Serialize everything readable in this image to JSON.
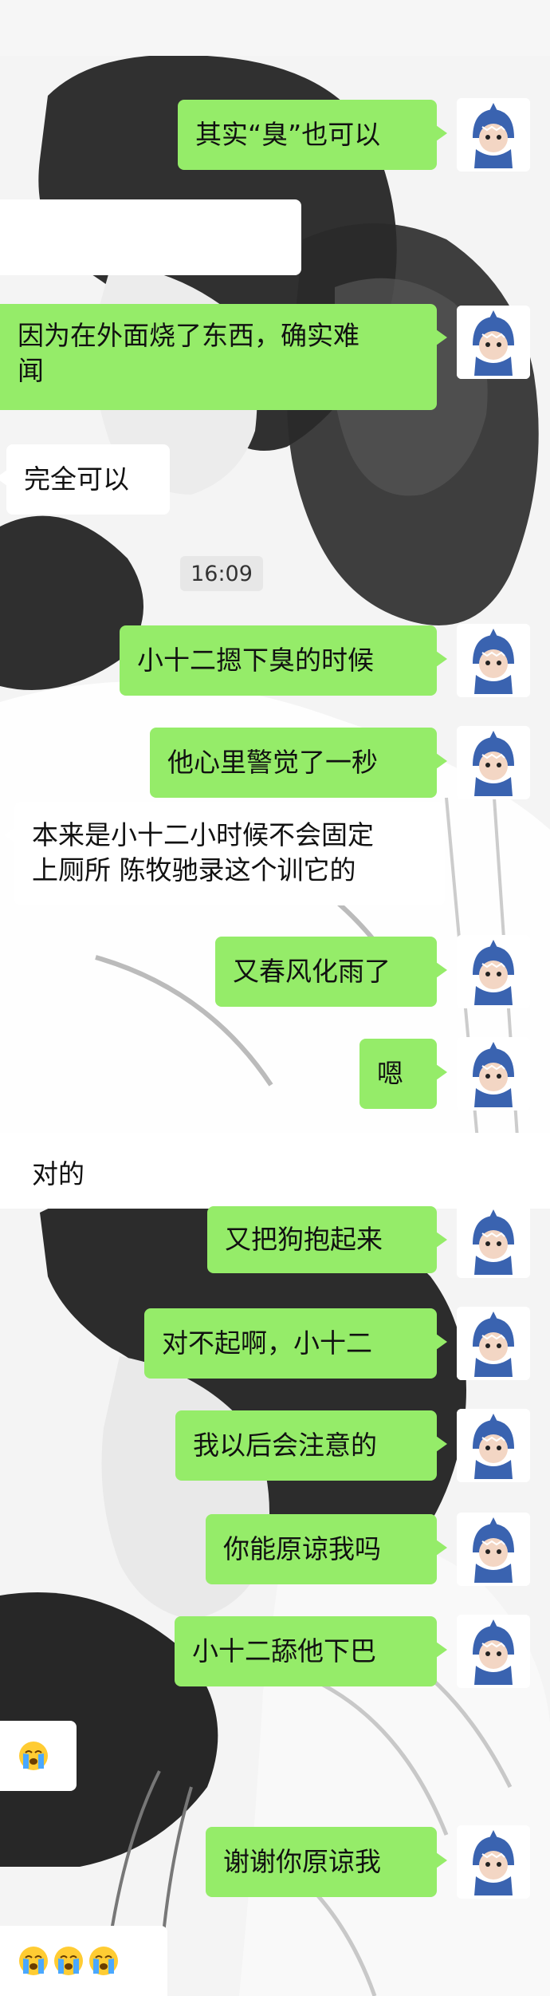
{
  "timestamp": "16:09",
  "messages": [
    {
      "text": "其实“臭”也可以"
    },
    {
      "text": ""
    },
    {
      "text": "因为在外面烧了东西，确实难闻"
    },
    {
      "text": "完全可以"
    },
    {
      "text": "小十二摁下臭的时候"
    },
    {
      "text": "他心里警觉了一秒"
    },
    {
      "text": "本来是小十二小时候不会固定上厕所 陈牧驰录这个训它的"
    },
    {
      "text": "又春风化雨了"
    },
    {
      "text": "嗯"
    },
    {
      "text": "对的"
    },
    {
      "text": "又把狗抱起来"
    },
    {
      "text": "对不起啊，小十二"
    },
    {
      "text": "我以后会注意的"
    },
    {
      "text": "你能原谅我吗"
    },
    {
      "text": "小十二舔他下巴"
    },
    {
      "text": "谢谢你原谅我"
    }
  ],
  "lines": {
    "m2_l1": "因为在外面烧了东西，确实难",
    "m2_l2": "闻",
    "m6_l1": "本来是小十二小时候不会固定",
    "m6_l2": "上厕所 陈牧驰录这个训它的"
  },
  "icons": {
    "avatar": "blue-shark-costume-avatar",
    "loudly_crying": "loudly-crying-face-emoji"
  },
  "colors": {
    "my_bubble": "#95ec69",
    "other_bubble": "#ffffff",
    "avatar_shark": "#3a63b0"
  }
}
